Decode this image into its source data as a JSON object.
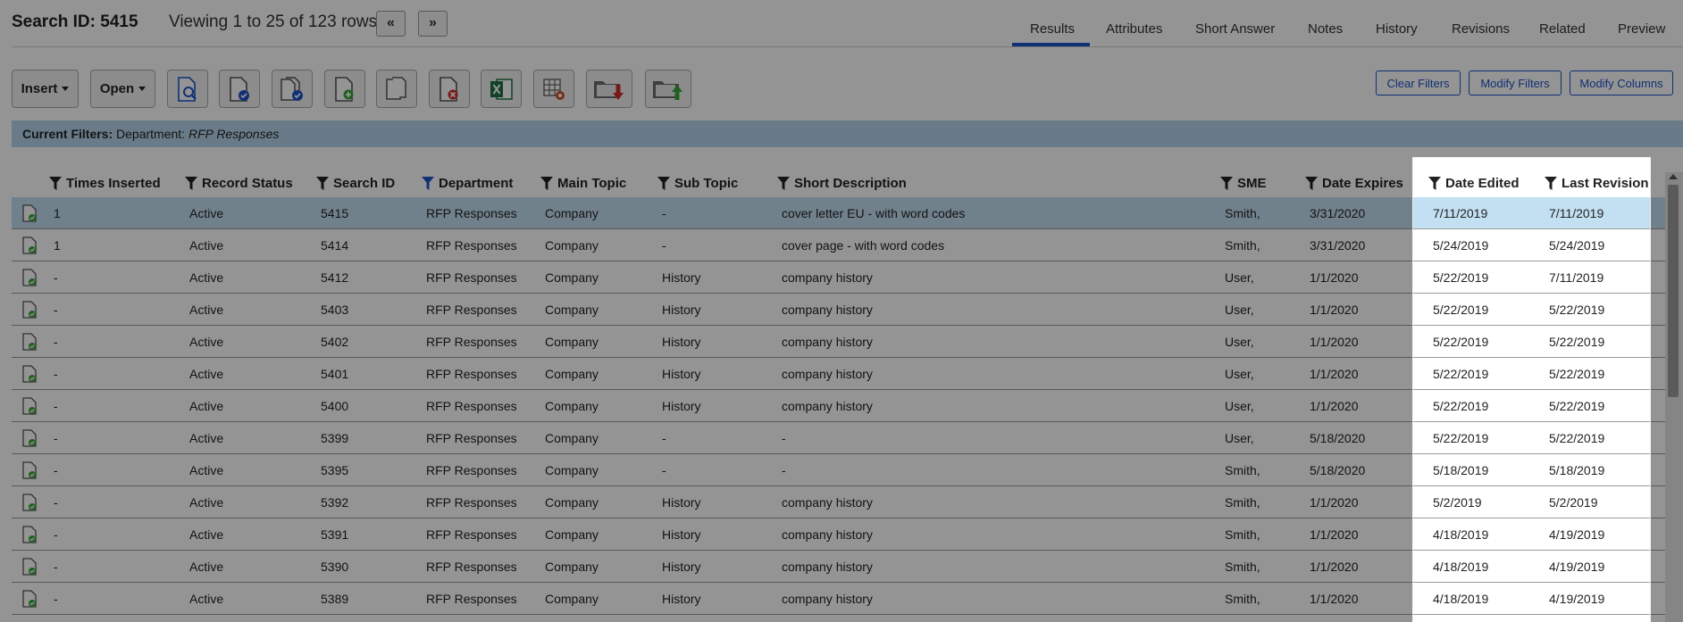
{
  "header": {
    "search_id": "Search ID: 5415",
    "viewing": "Viewing 1 to 25 of 123 rows",
    "prev_label": "«",
    "next_label": "»"
  },
  "tabs": [
    "Results",
    "Attributes",
    "Short Answer",
    "Notes",
    "History",
    "Revisions",
    "Related",
    "Preview"
  ],
  "active_tab": "Results",
  "toolbar": {
    "insert_label": "Insert",
    "open_label": "Open",
    "icons": [
      "search-document-icon",
      "check-document-icon",
      "check-multiple-documents-icon",
      "add-document-icon",
      "copy-documents-icon",
      "delete-document-icon",
      "excel-export-icon",
      "grid-settings-icon",
      "folder-download-icon",
      "folder-upload-icon"
    ],
    "clear_filters": "Clear Filters",
    "modify_filters": "Modify Filters",
    "modify_columns": "Modify Columns"
  },
  "filters": {
    "label": "Current Filters:",
    "field": "Department:",
    "value": "RFP Responses"
  },
  "columns": [
    "Times Inserted",
    "Record Status",
    "Search ID",
    "Department",
    "Main Topic",
    "Sub Topic",
    "Short Description",
    "SME",
    "Date Expires",
    "Date Edited",
    "Last Revision"
  ],
  "active_filter_column": "Department",
  "rows": [
    [
      "1",
      "Active",
      "5415",
      "RFP Responses",
      "Company",
      "-",
      "cover letter EU - with word codes",
      "Smith,",
      "3/31/2020",
      "7/11/2019",
      "7/11/2019"
    ],
    [
      "1",
      "Active",
      "5414",
      "RFP Responses",
      "Company",
      "-",
      "cover page - with word codes",
      "Smith,",
      "3/31/2020",
      "5/24/2019",
      "5/24/2019"
    ],
    [
      "-",
      "Active",
      "5412",
      "RFP Responses",
      "Company",
      "History",
      "company history",
      "User,",
      "1/1/2020",
      "5/22/2019",
      "7/11/2019"
    ],
    [
      "-",
      "Active",
      "5403",
      "RFP Responses",
      "Company",
      "History",
      "company history",
      "User,",
      "1/1/2020",
      "5/22/2019",
      "5/22/2019"
    ],
    [
      "-",
      "Active",
      "5402",
      "RFP Responses",
      "Company",
      "History",
      "company history",
      "User,",
      "1/1/2020",
      "5/22/2019",
      "5/22/2019"
    ],
    [
      "-",
      "Active",
      "5401",
      "RFP Responses",
      "Company",
      "History",
      "company history",
      "User,",
      "1/1/2020",
      "5/22/2019",
      "5/22/2019"
    ],
    [
      "-",
      "Active",
      "5400",
      "RFP Responses",
      "Company",
      "History",
      "company history",
      "User,",
      "1/1/2020",
      "5/22/2019",
      "5/22/2019"
    ],
    [
      "-",
      "Active",
      "5399",
      "RFP Responses",
      "Company",
      "-",
      "-",
      "User,",
      "5/18/2020",
      "5/22/2019",
      "5/22/2019"
    ],
    [
      "-",
      "Active",
      "5395",
      "RFP Responses",
      "Company",
      "-",
      "-",
      "Smith,",
      "5/18/2020",
      "5/18/2019",
      "5/18/2019"
    ],
    [
      "-",
      "Active",
      "5392",
      "RFP Responses",
      "Company",
      "History",
      "company history",
      "Smith,",
      "1/1/2020",
      "5/2/2019",
      "5/2/2019"
    ],
    [
      "-",
      "Active",
      "5391",
      "RFP Responses",
      "Company",
      "History",
      "company history",
      "Smith,",
      "1/1/2020",
      "4/18/2019",
      "4/19/2019"
    ],
    [
      "-",
      "Active",
      "5390",
      "RFP Responses",
      "Company",
      "History",
      "company history",
      "Smith,",
      "1/1/2020",
      "4/18/2019",
      "4/19/2019"
    ],
    [
      "-",
      "Active",
      "5389",
      "RFP Responses",
      "Company",
      "History",
      "company history",
      "Smith,",
      "1/1/2020",
      "4/18/2019",
      "4/19/2019"
    ]
  ],
  "selected_row": 0,
  "highlighted_columns": [
    "Date Edited",
    "Last Revision"
  ],
  "colors": {
    "accent": "#1d54c8",
    "filter_bar": "#b6d5ea",
    "selected_row": "#c3dff2",
    "doc_check": "#3aa53a"
  }
}
